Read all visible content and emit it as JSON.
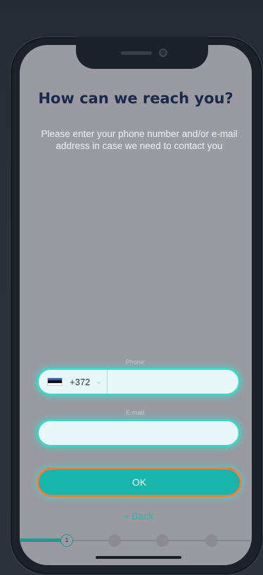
{
  "screen": {
    "title": "How can we reach you?",
    "subtitle": "Please enter your phone number and/or e-mail address in case we need to contact you"
  },
  "phone": {
    "label": "Phone:",
    "country_flag": "estonia-flag",
    "dial_code": "+372",
    "value": "",
    "placeholder": ""
  },
  "email": {
    "label": "E-mail:",
    "value": "",
    "placeholder": ""
  },
  "actions": {
    "ok_label": "OK",
    "back_label": "« Back"
  },
  "progress": {
    "current_step": "1",
    "total_steps": 4,
    "fill_fraction": 0.18
  },
  "colors": {
    "accent": "#17b5ab",
    "field_glow": "#3fd4c6",
    "ok_border": "#ff7a3c",
    "title": "#1a2a4c"
  }
}
